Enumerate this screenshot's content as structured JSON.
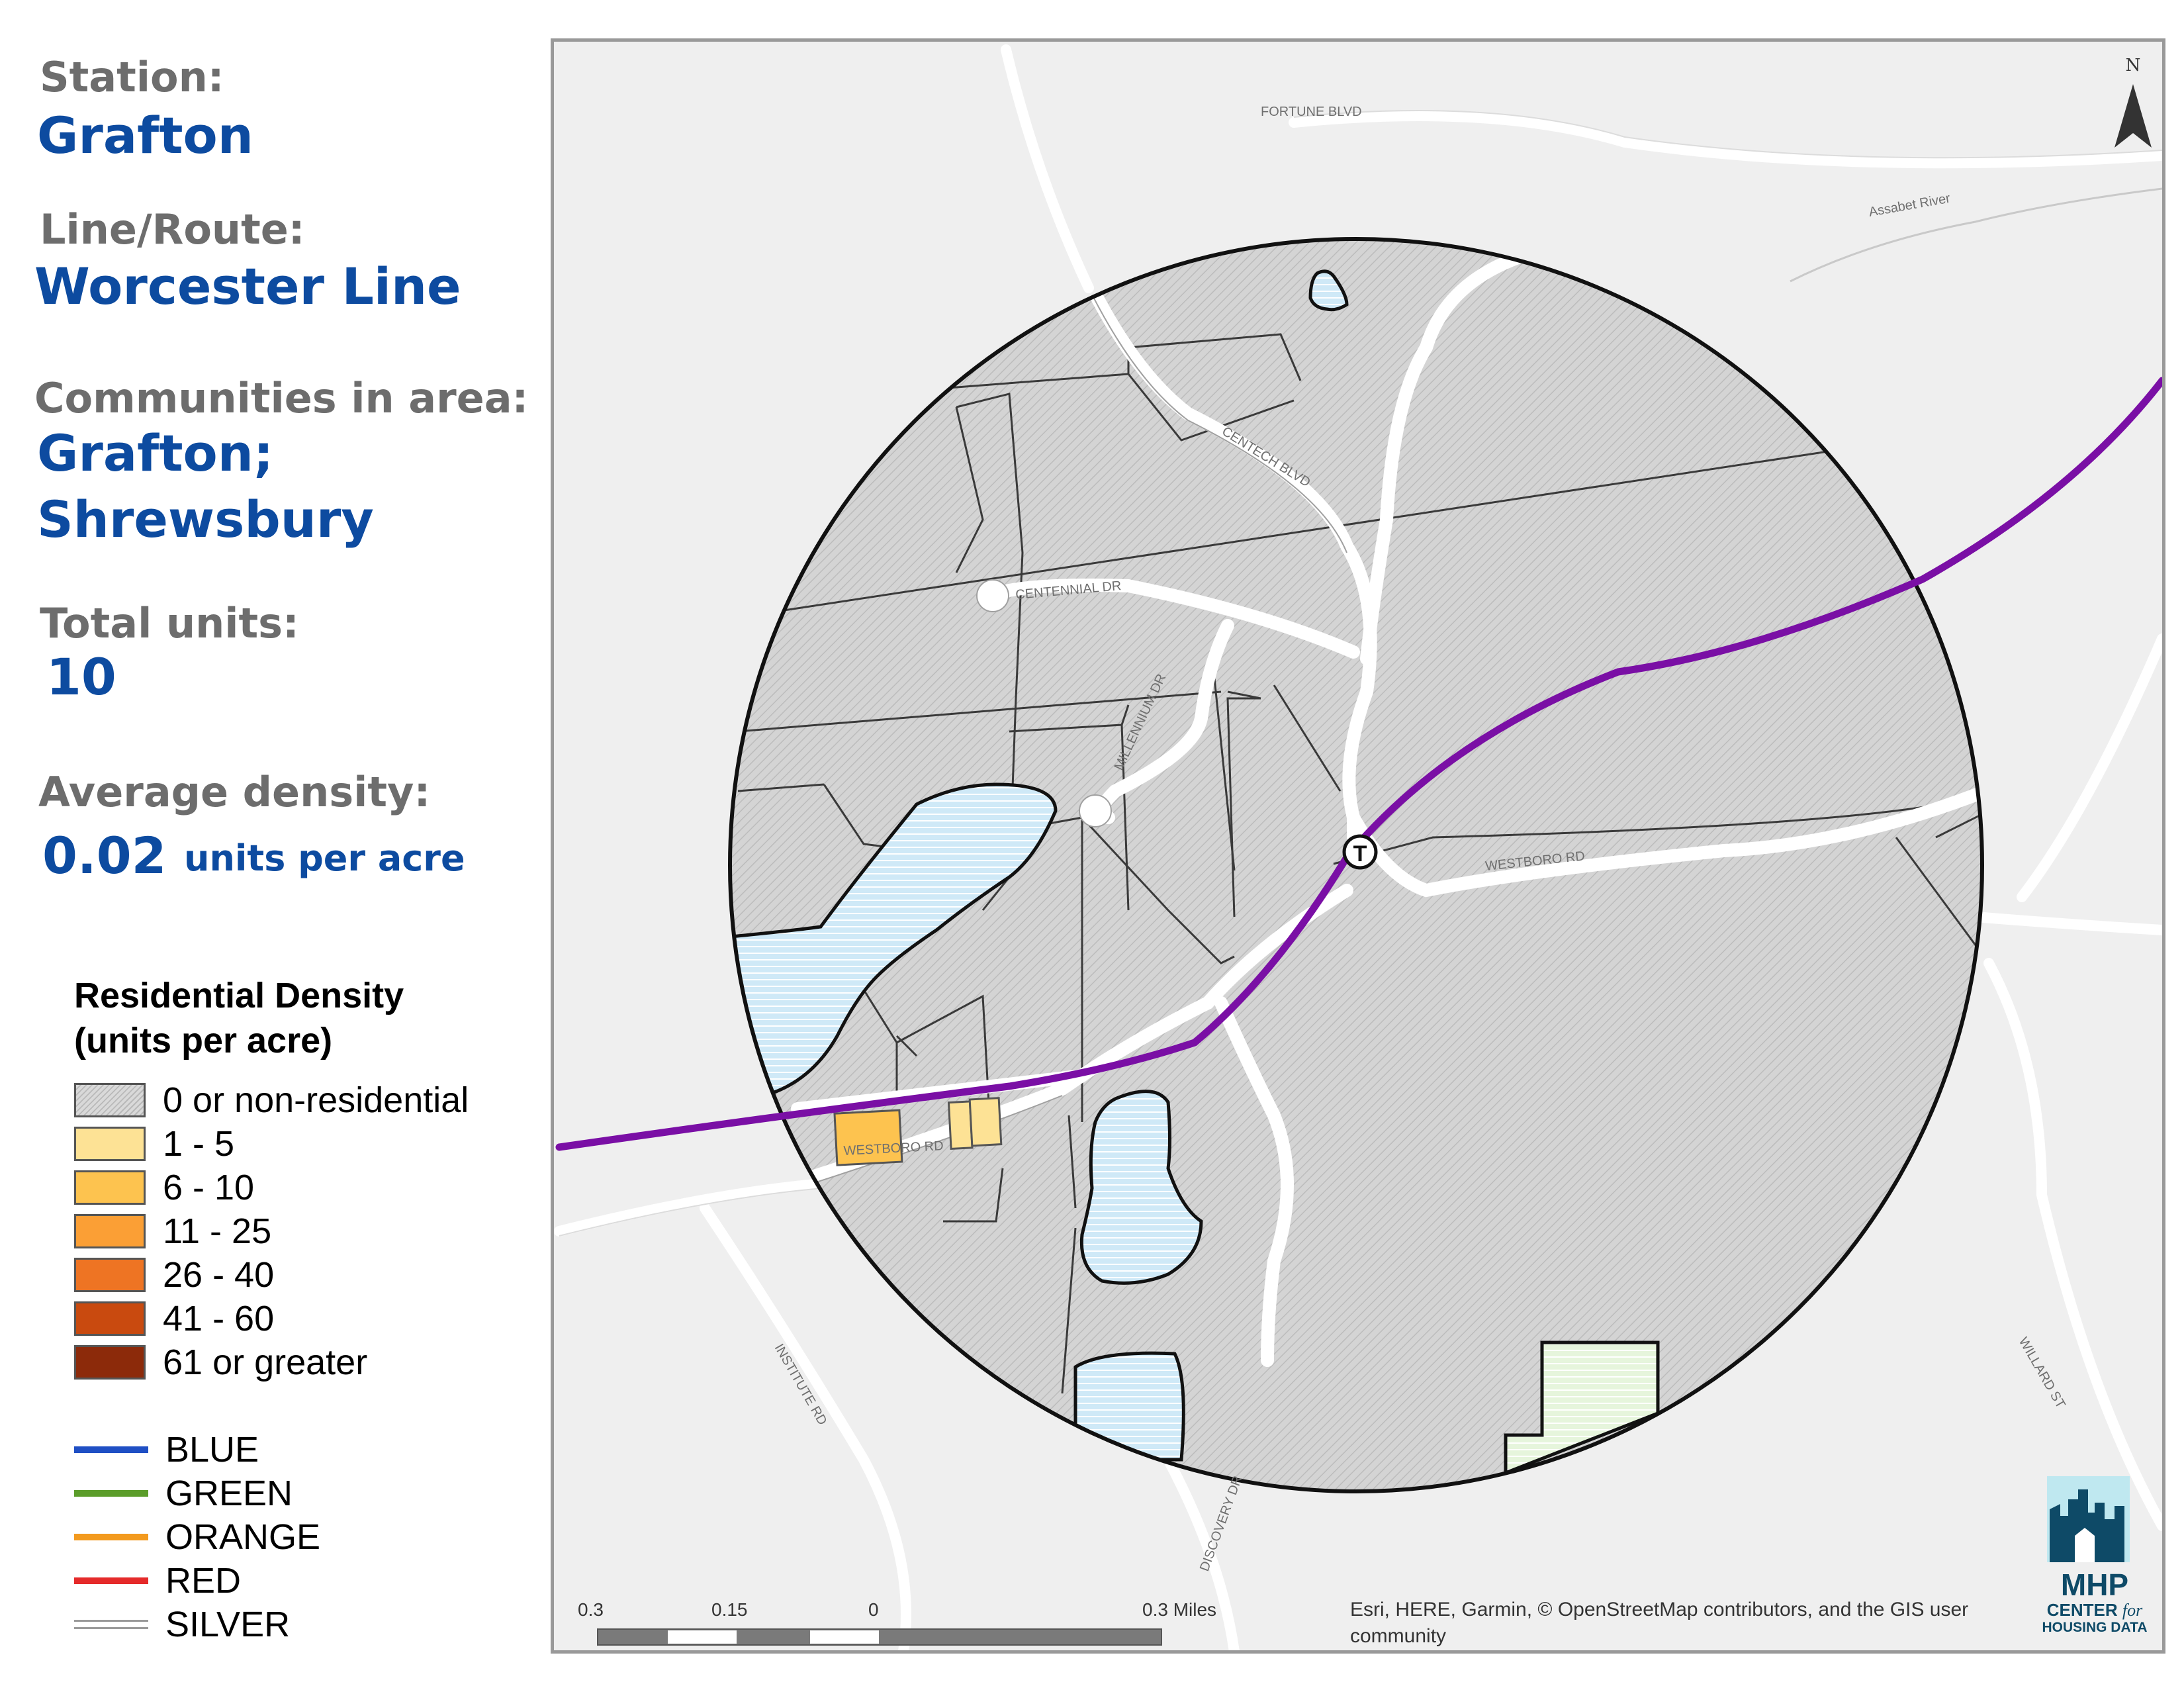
{
  "station": {
    "label": "Station:",
    "value": "Grafton"
  },
  "line_route": {
    "label": "Line/Route:",
    "value": "Worcester Line"
  },
  "communities": {
    "label": "Communities in area:",
    "values": [
      "Grafton;",
      "Shrewsbury"
    ]
  },
  "total_units": {
    "label": "Total units:",
    "value": "10"
  },
  "average_density": {
    "label": "Average density:",
    "value": "0.02",
    "unit": "units per acre"
  },
  "legend": {
    "title_lines": [
      "Residential Density",
      "(units per acre)"
    ],
    "density_classes": [
      {
        "label": "0 or non-residential",
        "color": "hatch-gray"
      },
      {
        "label": "1 - 5",
        "color": "#fde295"
      },
      {
        "label": "6 - 10",
        "color": "#fdc34f"
      },
      {
        "label": "11 - 25",
        "color": "#fb9f35"
      },
      {
        "label": "26 - 40",
        "color": "#ee7423"
      },
      {
        "label": "41 - 60",
        "color": "#c94a0f"
      },
      {
        "label": "61 or greater",
        "color": "#8c2a0a"
      }
    ],
    "transit_lines": [
      {
        "label": "BLUE",
        "color": "#1f4fc4"
      },
      {
        "label": "GREEN",
        "color": "#5b9d2a"
      },
      {
        "label": "ORANGE",
        "color": "#f39a1e"
      },
      {
        "label": "RED",
        "color": "#e52a2a"
      },
      {
        "label": "SILVER",
        "color": "#9a9a9a"
      }
    ]
  },
  "map": {
    "north_label": "N",
    "station_symbol": "T",
    "rail_line_color": "#7a0fa5",
    "street_labels": [
      "FORTUNE BLVD",
      "CENTECH BLVD",
      "CENTENNIAL DR",
      "MILLENNIUM DR",
      "WESTBORO RD",
      "DISCOVERY DR",
      "INSTITUTE RD",
      "WILLARD ST"
    ],
    "water_labels": [
      "Assabet River"
    ],
    "scale_bar": {
      "ticks": [
        "0.3",
        "0.15",
        "0",
        "0.3 Miles"
      ]
    },
    "attribution": "Esri, HERE, Garmin, © OpenStreetMap contributors, and the GIS user community"
  },
  "logo": {
    "line1": "MHP",
    "line2a": "CENTER",
    "line2b": "for",
    "line3": "HOUSING DATA"
  }
}
